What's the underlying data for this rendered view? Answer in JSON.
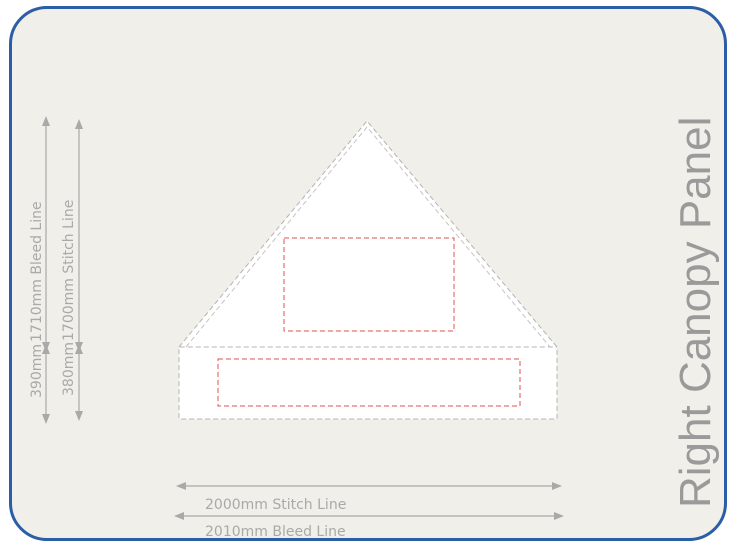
{
  "panel": {
    "title": "Right Canopy Panel",
    "colors": {
      "frame_border": "#2b5ea7",
      "background": "#f1efe9",
      "panel_fill": "#ffffff",
      "guide_gray": "#a9a9a9",
      "safe_zone_red": "#e05050"
    }
  },
  "dimensions": {
    "vertical_left": {
      "bleed_top": "1710mm Bleed Line",
      "bleed_bottom": "390mm"
    },
    "vertical_right": {
      "stitch_top": "1700mm Stitch Line",
      "stitch_bottom": "380mm"
    },
    "horizontal": {
      "stitch": "2000mm Stitch Line",
      "bleed": "2010mm Bleed Line"
    }
  }
}
